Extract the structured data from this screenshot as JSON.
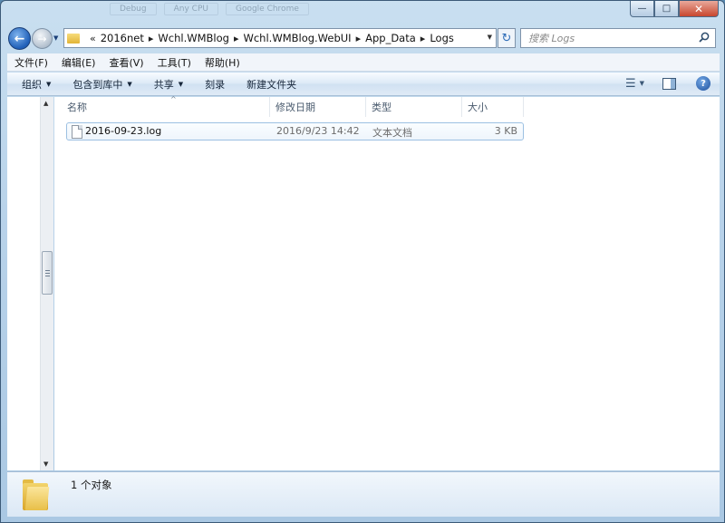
{
  "window": {
    "background_tabs": [
      "Debug",
      "Any CPU",
      "Google Chrome"
    ],
    "caption": {
      "minimize": "—",
      "maximize": "□",
      "close": "✕"
    }
  },
  "nav": {
    "back_glyph": "←",
    "forward_glyph": "→",
    "history_dropdown": "▼",
    "breadcrumb_overflow": "«",
    "breadcrumb_sep": "▸",
    "breadcrumb": [
      "2016net",
      "Wchl.WMBlog",
      "Wchl.WMBlog.WebUI",
      "App_Data",
      "Logs"
    ],
    "address_dropdown": "▼",
    "refresh_glyph": "↻",
    "search_placeholder": "搜索 Logs",
    "search_icon": "search-icon"
  },
  "menubar": [
    "文件(F)",
    "编辑(E)",
    "查看(V)",
    "工具(T)",
    "帮助(H)"
  ],
  "commandbar": {
    "organize": "组织",
    "include_in_library": "包含到库中",
    "share": "共享",
    "burn": "刻录",
    "new_folder": "新建文件夹",
    "dropdown_glyph": "▼",
    "views_glyph": "☰",
    "help_glyph": "?"
  },
  "columns": {
    "name": "名称",
    "date": "修改日期",
    "type": "类型",
    "size": "大小",
    "sort_glyph": "^"
  },
  "files": [
    {
      "name": "2016-09-23.log",
      "date": "2016/9/23 14:42",
      "type": "文本文档",
      "size": "3 KB"
    }
  ],
  "scrollbar": {
    "up_glyph": "▲",
    "down_glyph": "▼"
  },
  "details": {
    "status": "1 个对象"
  }
}
